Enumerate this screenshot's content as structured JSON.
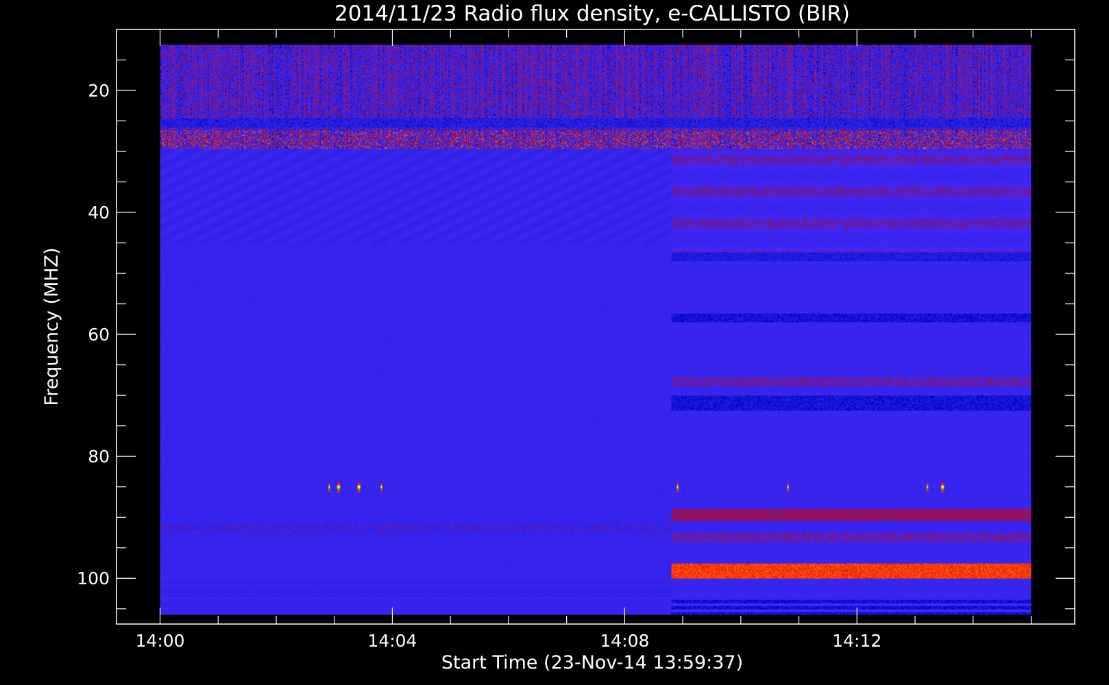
{
  "chart_data": {
    "type": "heatmap",
    "title": "2014/11/23  Radio flux density, e-CALLISTO (BIR)",
    "xlabel": "Start Time (23-Nov-14 13:59:37)",
    "ylabel": "Frequency (MHZ)",
    "x_ticks": [
      {
        "t": 0,
        "label": "14:00"
      },
      {
        "t": 4,
        "label": "14:04"
      },
      {
        "t": 8,
        "label": "14:08"
      },
      {
        "t": 12,
        "label": "14:12"
      }
    ],
    "y_ticks": [
      {
        "v": 20,
        "label": "20"
      },
      {
        "v": 40,
        "label": "40"
      },
      {
        "v": 60,
        "label": "60"
      },
      {
        "v": 80,
        "label": "80"
      },
      {
        "v": 100,
        "label": "100"
      }
    ],
    "xlim_minutes_after_1400": [
      -0.75,
      15.75
    ],
    "ylim_mhz": [
      10,
      107.5
    ],
    "data_extent_minutes_after_1400": [
      0,
      15
    ],
    "data_extent_mhz": [
      12.5,
      106
    ],
    "y_inverted": true,
    "receiver_change_minutes_after_1400": 8.8,
    "colors": {
      "background_band": "#2a2aee",
      "low": "#000000",
      "mid": "#8a1a3a",
      "high": "#ff2200",
      "peak": "#ffff00"
    }
  }
}
